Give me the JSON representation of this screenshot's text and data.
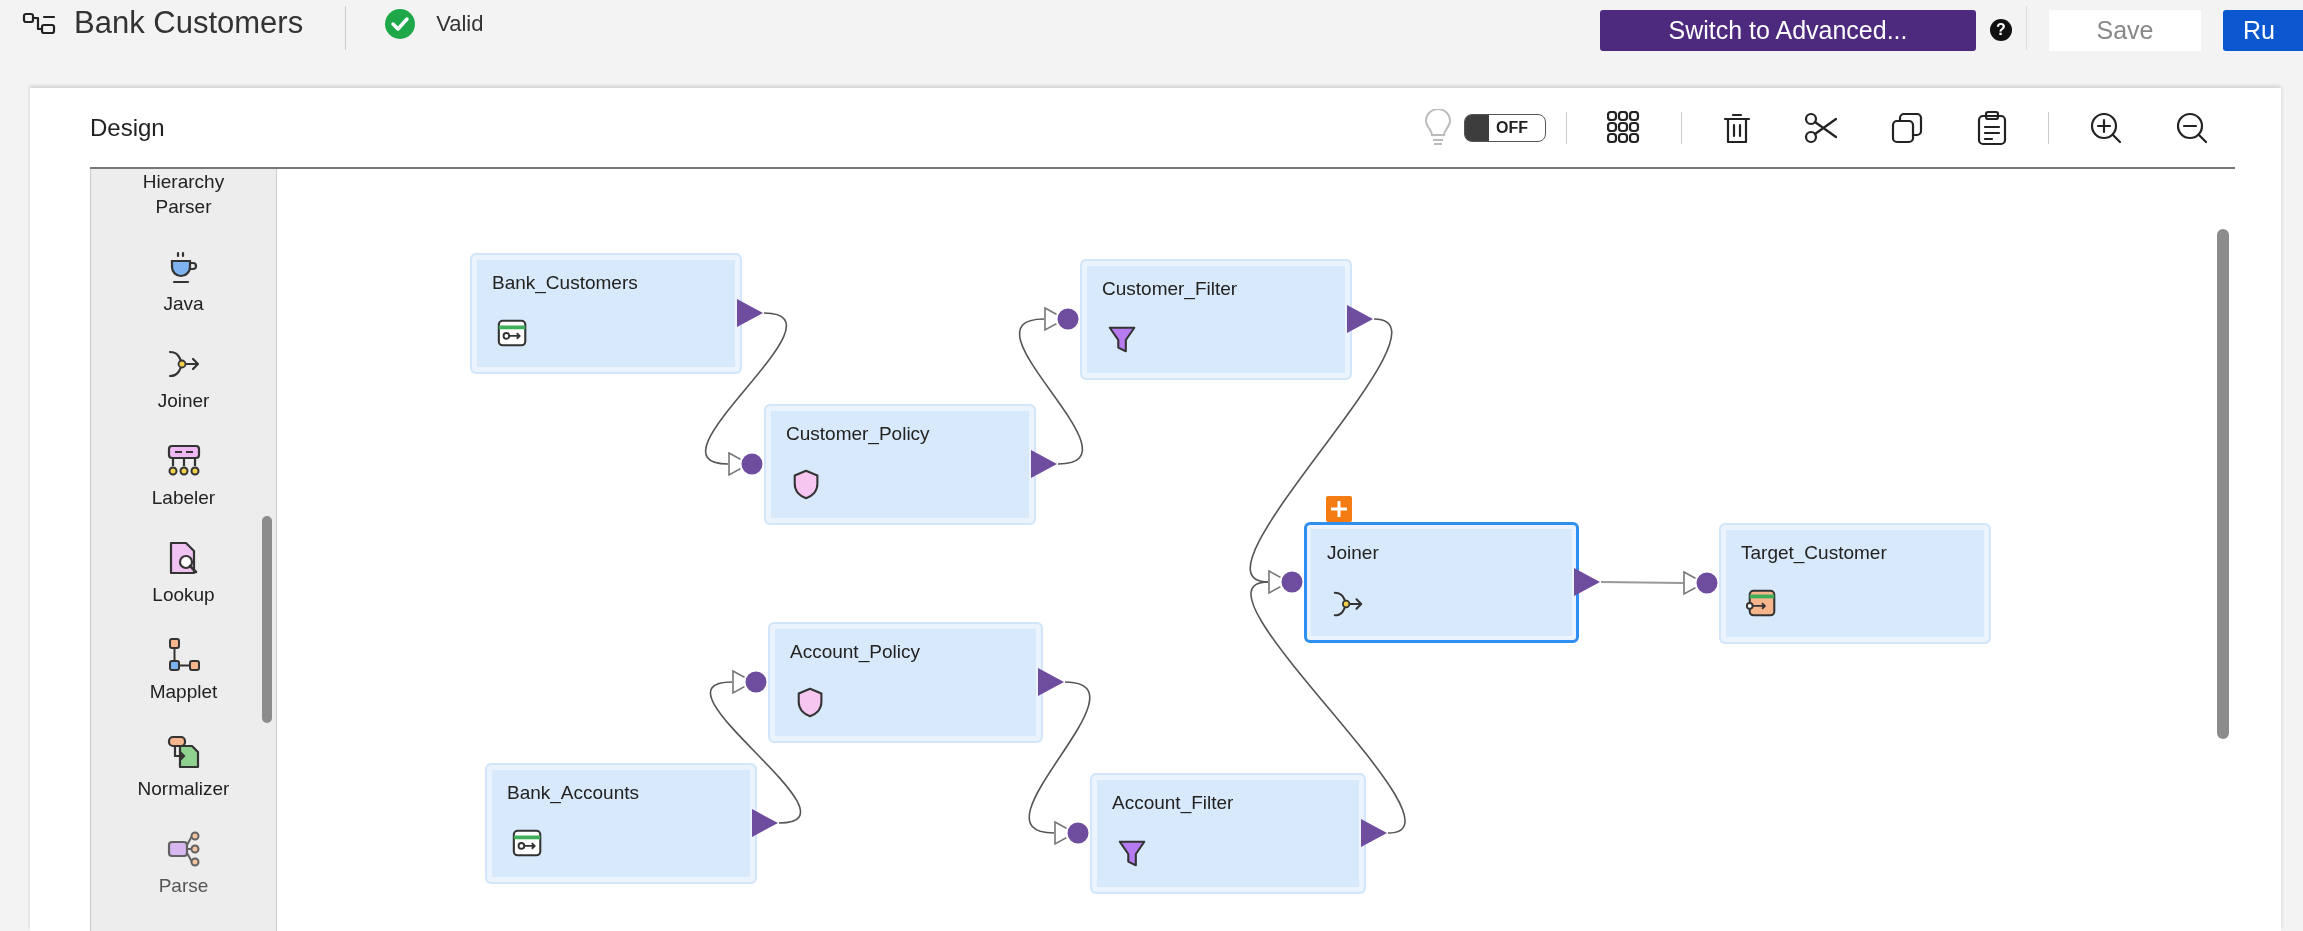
{
  "header": {
    "title": "Bank Customers",
    "status": "Valid",
    "help": "?",
    "buttons": [
      {
        "label": "Switch to Advanced...",
        "kind": "advanced"
      },
      {
        "label": "Save",
        "kind": "secondary"
      },
      {
        "label": "Ru",
        "kind": "primary"
      }
    ]
  },
  "design": {
    "title": "Design",
    "toggle": {
      "label": "OFF",
      "on": false
    }
  },
  "palette": [
    {
      "label": "Hierarchy Parser",
      "kind": "hierarchy-parser"
    },
    {
      "label": "Java",
      "kind": "java"
    },
    {
      "label": "Joiner",
      "kind": "joiner"
    },
    {
      "label": "Labeler",
      "kind": "labeler"
    },
    {
      "label": "Lookup",
      "kind": "lookup"
    },
    {
      "label": "Mapplet",
      "kind": "mapplet"
    },
    {
      "label": "Normalizer",
      "kind": "normalizer"
    },
    {
      "label": "Parse",
      "kind": "parse"
    }
  ],
  "nodes": [
    {
      "label": "Bank_Customers",
      "kind": "source",
      "selected": false,
      "badge": false
    },
    {
      "label": "Customer_Filter",
      "kind": "filter",
      "selected": false,
      "badge": false
    },
    {
      "label": "Customer_Policy",
      "kind": "policy",
      "selected": false,
      "badge": false
    },
    {
      "label": "Joiner",
      "kind": "joiner",
      "selected": true,
      "badge": true
    },
    {
      "label": "Target_Customer",
      "kind": "target",
      "selected": false,
      "badge": false
    },
    {
      "label": "Account_Policy",
      "kind": "policy",
      "selected": false,
      "badge": false
    },
    {
      "label": "Bank_Accounts",
      "kind": "source",
      "selected": false,
      "badge": false
    },
    {
      "label": "Account_Filter",
      "kind": "filter",
      "selected": false,
      "badge": false
    }
  ]
}
